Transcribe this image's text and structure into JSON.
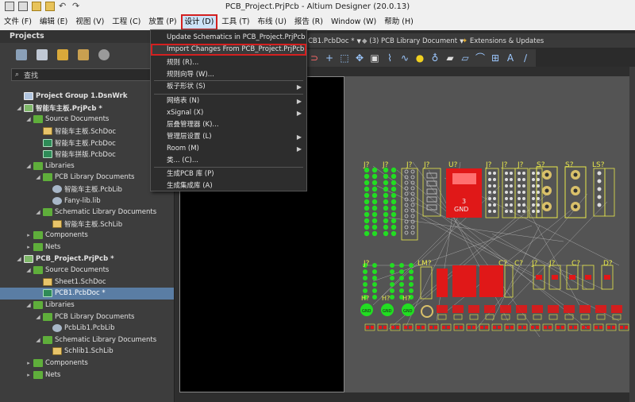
{
  "titlebar": {
    "title": "PCB_Project.PrjPcb - Altium Designer (20.0.13)"
  },
  "menubar": {
    "items": [
      "文件 (F)",
      "编辑 (E)",
      "视图 (V)",
      "工程 (C)",
      "放置 (P)",
      "设计 (D)",
      "工具 (T)",
      "布线 (U)",
      "报告 (R)",
      "Window (W)",
      "帮助 (H)"
    ],
    "active_index": 5
  },
  "panel": {
    "title": "Projects",
    "search_placeholder": "查找",
    "tree": [
      {
        "label": "Project Group 1.DsnWrk",
        "level": 0,
        "icon": "group",
        "bold": true,
        "expand": ""
      },
      {
        "label": "智能车主板.PrjPcb *",
        "level": 0,
        "icon": "proj",
        "bold": true,
        "expand": "◢"
      },
      {
        "label": "Source Documents",
        "level": 1,
        "icon": "folder",
        "expand": "◢"
      },
      {
        "label": "智能车主板.SchDoc",
        "level": 2,
        "icon": "sch",
        "expand": ""
      },
      {
        "label": "智能车主板.PcbDoc",
        "level": 2,
        "icon": "pcb",
        "expand": ""
      },
      {
        "label": "智能车拼版.PcbDoc",
        "level": 2,
        "icon": "pcb",
        "expand": ""
      },
      {
        "label": "Libraries",
        "level": 1,
        "icon": "folder",
        "expand": "◢"
      },
      {
        "label": "PCB Library Documents",
        "level": 2,
        "icon": "folder",
        "expand": "◢"
      },
      {
        "label": "智能车主板.PcbLib",
        "level": 3,
        "icon": "lib",
        "expand": ""
      },
      {
        "label": "Fany-lib.lib",
        "level": 3,
        "icon": "lib",
        "expand": ""
      },
      {
        "label": "Schematic Library Documents",
        "level": 2,
        "icon": "folder",
        "expand": "◢"
      },
      {
        "label": "智能车主板.SchLib",
        "level": 3,
        "icon": "sch",
        "expand": ""
      },
      {
        "label": "Components",
        "level": 1,
        "icon": "folder",
        "expand": "▸"
      },
      {
        "label": "Nets",
        "level": 1,
        "icon": "folder",
        "expand": "▸"
      },
      {
        "label": "PCB_Project.PrjPcb *",
        "level": 0,
        "icon": "proj",
        "bold": true,
        "expand": "◢"
      },
      {
        "label": "Source Documents",
        "level": 1,
        "icon": "folder",
        "expand": "◢"
      },
      {
        "label": "Sheet1.SchDoc",
        "level": 2,
        "icon": "sch",
        "expand": ""
      },
      {
        "label": "PCB1.PcbDoc *",
        "level": 2,
        "icon": "pcb",
        "expand": "",
        "selected": true
      },
      {
        "label": "Libraries",
        "level": 1,
        "icon": "folder",
        "expand": "◢"
      },
      {
        "label": "PCB Library Documents",
        "level": 2,
        "icon": "folder",
        "expand": "◢"
      },
      {
        "label": "PcbLib1.PcbLib",
        "level": 3,
        "icon": "lib",
        "expand": ""
      },
      {
        "label": "Schematic Library Documents",
        "level": 2,
        "icon": "folder",
        "expand": "◢"
      },
      {
        "label": "Schlib1.SchLib",
        "level": 3,
        "icon": "sch",
        "expand": ""
      },
      {
        "label": "Components",
        "level": 1,
        "icon": "folder",
        "expand": "▸"
      },
      {
        "label": "Nets",
        "level": 1,
        "icon": "folder",
        "expand": "▸"
      }
    ]
  },
  "doctabs": {
    "pcb1": "CB1.PcbDoc *",
    "pcblib": "(3) PCB Library Document",
    "extensions": "Extensions & Updates"
  },
  "design_menu": {
    "items": [
      {
        "label": "Update Schematics in PCB_Project.PrjPcb",
        "submenu": false
      },
      {
        "label": "Import Changes From PCB_Project.PrjPcb",
        "submenu": false,
        "highlight": true
      },
      {
        "label": "规则 (R)...",
        "submenu": false
      },
      {
        "label": "规则向导 (W)...",
        "submenu": false
      },
      {
        "label": "板子形状 (S)",
        "submenu": true,
        "sep_before": true
      },
      {
        "label": "网络表 (N)",
        "submenu": true,
        "sep_before": true
      },
      {
        "label": "xSignal (X)",
        "submenu": true
      },
      {
        "label": "层叠管理器 (K)...",
        "submenu": false
      },
      {
        "label": "管理层设置 (L)",
        "submenu": true
      },
      {
        "label": "Room (M)",
        "submenu": true
      },
      {
        "label": "类... (C)...",
        "submenu": false
      },
      {
        "label": "生成PCB 库 (P)",
        "submenu": false,
        "sep_before": true
      },
      {
        "label": "生成集成库 (A)",
        "submenu": false
      }
    ]
  },
  "pcb": {
    "designators_top": [
      "J?",
      "J?",
      "J?",
      "J?",
      "U?",
      "J?",
      "J?",
      "J?",
      "S?",
      "S?",
      "LS?"
    ],
    "designators_mid": [
      "J?",
      "LM?",
      "C?",
      "C?",
      "J?",
      "J?",
      "C?",
      "D?"
    ],
    "designators_low": [
      "H?",
      "H?",
      "H?"
    ],
    "pad_label": "GND",
    "pin_label": "3",
    "colors": {
      "board": "#545454",
      "pad_green": "#22dd22",
      "smd_red": "#e01818",
      "silk": "#e8e84a",
      "ratsnest": "#c8c8c8",
      "copper": "#d9c06a"
    }
  }
}
